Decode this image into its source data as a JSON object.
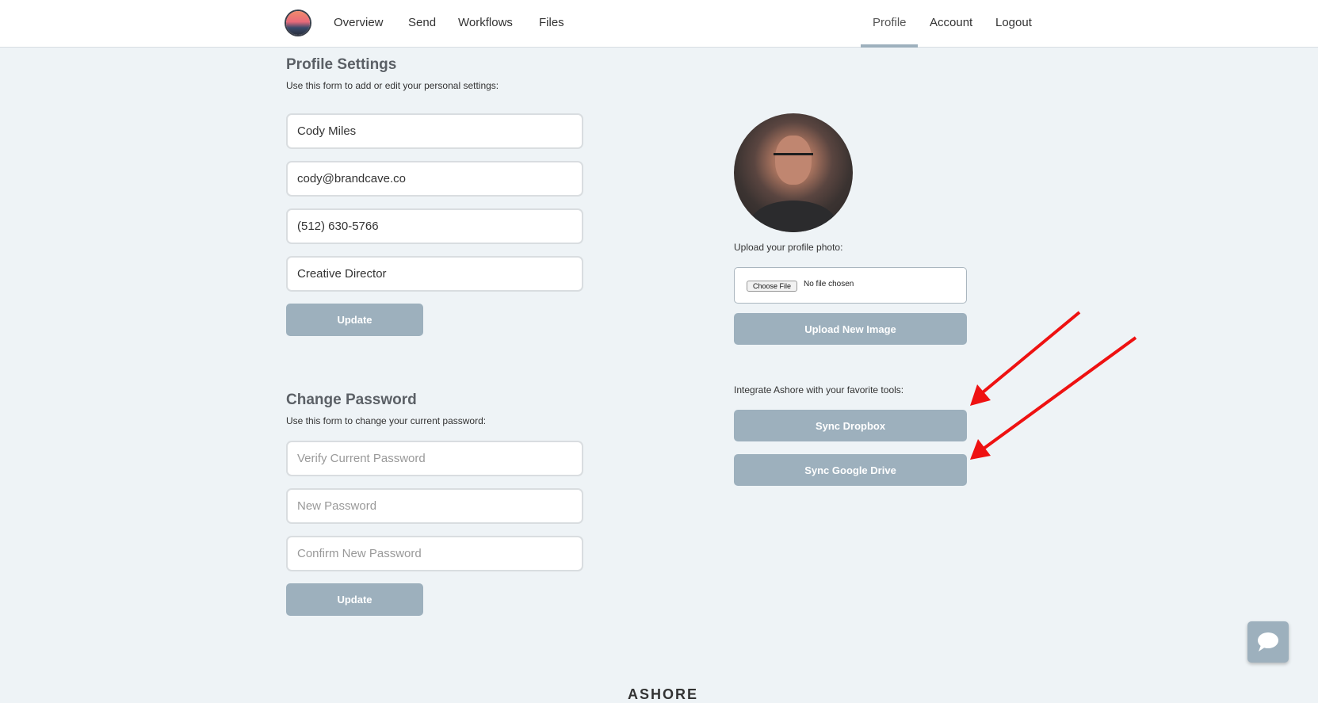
{
  "nav": {
    "left": [
      "Overview",
      "Send",
      "Workflows",
      "Files"
    ],
    "right": [
      "Profile",
      "Account",
      "Logout"
    ],
    "active": "Profile"
  },
  "profile": {
    "title": "Profile Settings",
    "description": "Use this form to add or edit your personal settings:",
    "name": "Cody Miles",
    "email": "cody@brandcave.co",
    "phone": "(512) 630-5766",
    "job_title": "Creative Director",
    "update_label": "Update"
  },
  "password": {
    "title": "Change Password",
    "description": "Use this form to change your current password:",
    "current_placeholder": "Verify Current Password",
    "new_placeholder": "New Password",
    "confirm_placeholder": "Confirm New Password",
    "update_label": "Update"
  },
  "photo": {
    "label": "Upload your profile photo:",
    "choose_label": "Choose File",
    "no_file_label": "No file chosen",
    "upload_label": "Upload New Image"
  },
  "integrations": {
    "label": "Integrate Ashore with your favorite tools:",
    "dropbox_label": "Sync Dropbox",
    "gdrive_label": "Sync Google Drive"
  },
  "footer": {
    "logo_text": "ASHORE"
  },
  "colors": {
    "accent": "#9db0bd",
    "background": "#eef3f6",
    "annotation_arrow": "#ee1111"
  }
}
